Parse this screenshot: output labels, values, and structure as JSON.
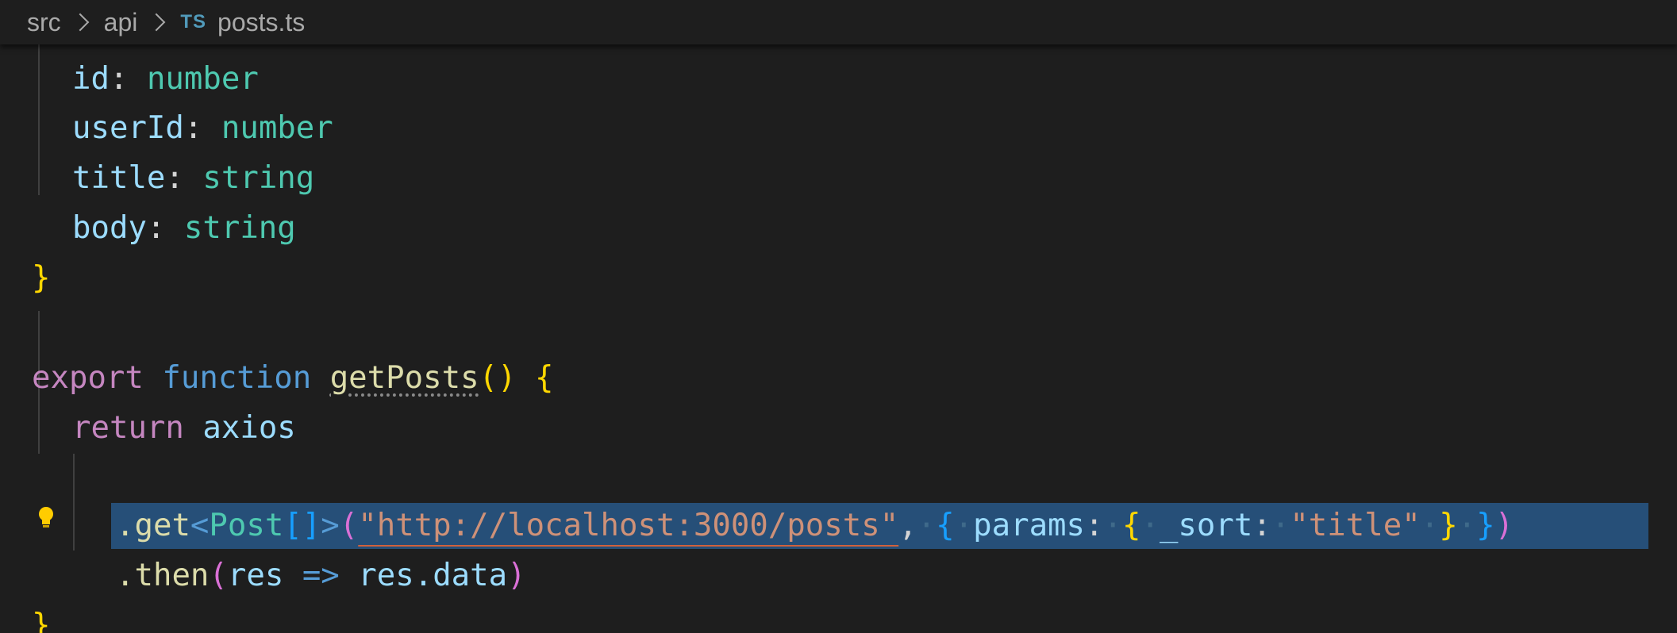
{
  "breadcrumb": {
    "items": [
      "src",
      "api"
    ],
    "file_icon": "TS",
    "file_name": "posts.ts"
  },
  "code": {
    "l1": {
      "prop": "id",
      "colon": ":",
      "type": "number"
    },
    "l2": {
      "prop": "userId",
      "colon": ":",
      "type": "number"
    },
    "l3": {
      "prop": "title",
      "colon": ":",
      "type": "string"
    },
    "l4": {
      "prop": "body",
      "colon": ":",
      "type": "string"
    },
    "l5": {
      "brace": "}"
    },
    "l7": {
      "kw": "export",
      "fnkw": "function",
      "name": "getPosts",
      "parens": "()",
      "brace": "{"
    },
    "l8": {
      "kw": "return",
      "obj": "axios"
    },
    "l9": {
      "method": ".get",
      "lt": "<",
      "generic": "Post",
      "arr": "[]",
      "gt": ">",
      "open": "(",
      "url": "\"http://localhost:3000/posts\"",
      "comma": ",",
      "ob1": "{",
      "params": "params",
      "colon1": ":",
      "ob2": "{",
      "sort": "_sort",
      "colon2": ":",
      "sortval": "\"title\"",
      "cb2": "}",
      "cb1": "}",
      "close": ")"
    },
    "l10": {
      "method": ".then",
      "open": "(",
      "param": "res",
      "arrow": "=>",
      "ret": "res.data",
      "close": ")"
    },
    "l11": {
      "brace": "}"
    }
  },
  "icons": {
    "lightbulb": "lightbulb-icon"
  },
  "colors": {
    "background": "#1e1e1e",
    "selection": "#264f78",
    "property": "#9cdcfe",
    "type": "#4ec9b0",
    "keyword": "#c586c0",
    "function": "#dcdcaa",
    "string": "#ce9178"
  }
}
